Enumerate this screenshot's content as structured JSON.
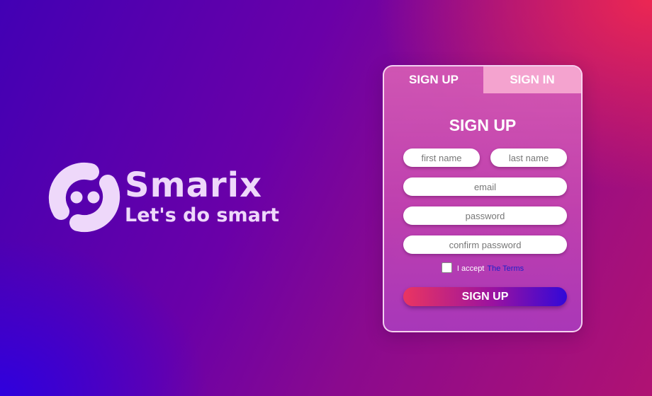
{
  "brand": {
    "name": "Smarix",
    "tagline": "Let's do smart",
    "logo_icon": "smarix-logo-icon",
    "text_color": "#eed8fa"
  },
  "tabs": [
    {
      "label": "SIGN UP",
      "active": true
    },
    {
      "label": "SIGN IN",
      "active": false
    }
  ],
  "form": {
    "title": "SIGN UP",
    "first_name_placeholder": "first name",
    "last_name_placeholder": "last name",
    "email_placeholder": "email",
    "password_placeholder": "password",
    "confirm_password_placeholder": "confirm password",
    "terms_text": "I accept",
    "terms_link": "The Terms",
    "terms_checked": false,
    "submit_label": "SIGN UP"
  },
  "colors": {
    "tab_inactive_bg": "#f4a3cf",
    "terms_link": "#2020c8",
    "button_gradient_start": "#ea3561",
    "button_gradient_end": "#3208d8"
  }
}
